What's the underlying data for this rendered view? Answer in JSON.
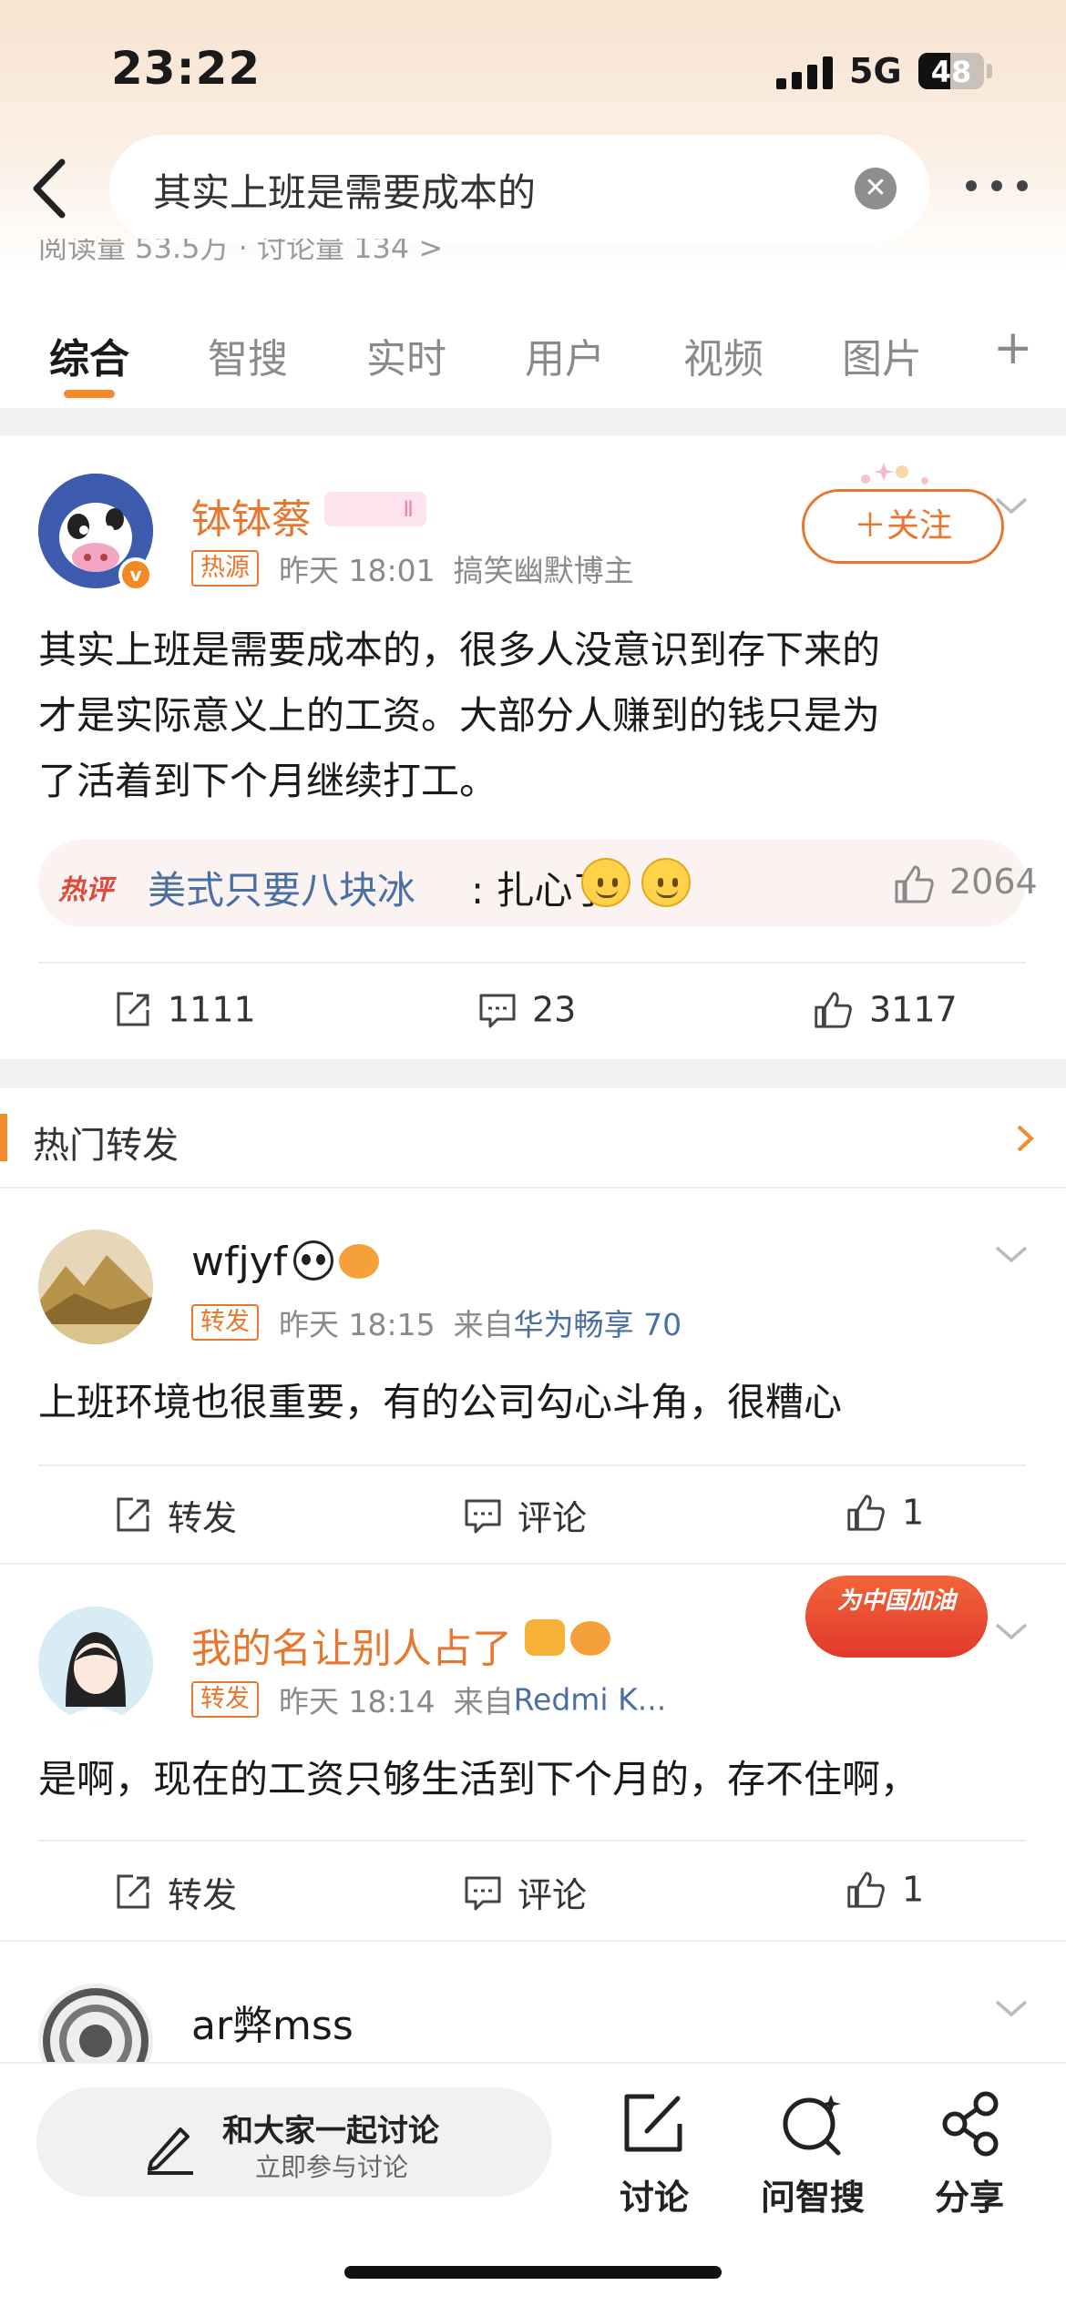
{
  "status": {
    "time": "23:22",
    "network": "5G",
    "battery": "48",
    "battery_level": 0.48
  },
  "search": {
    "query": "其实上班是需要成本的"
  },
  "peek": "阅读量 53.5万 · 讨论量 134 >",
  "tabs": [
    {
      "label": "综合"
    },
    {
      "label": "智搜"
    },
    {
      "label": "实时"
    },
    {
      "label": "用户"
    },
    {
      "label": "视频"
    },
    {
      "label": "图片"
    }
  ],
  "post": {
    "author": "钵钵蔡",
    "level": "Ⅱ",
    "tag": "热源",
    "time": "昨天 18:01",
    "desc": "搞笑幽默博主",
    "follow": "＋关注",
    "lines": [
      "其实上班是需要成本的，很多人没意识到存下来的",
      "才是实际意义上的工资。大部分人赚到的钱只是为",
      "了活着到下个月继续打工。"
    ],
    "hot_comment": {
      "label": "热评",
      "name": "美式只要八块冰",
      "text": ": 扎心了",
      "likes": "2064"
    },
    "reposts": "1111",
    "comments": "23",
    "likes": "3117"
  },
  "section_title": "热门转发",
  "reposts": [
    {
      "name": "wfjyf",
      "tag": "转发",
      "time": "昨天 18:15",
      "from": "来自",
      "device": "华为畅享 70",
      "text": "上班环境也很重要，有的公司勾心斗角，很糟心",
      "repost_label": "转发",
      "comment_label": "评论",
      "likes": "1"
    },
    {
      "name": "我的名让别人占了",
      "tag": "转发",
      "time": "昨天 18:14",
      "from": "来自",
      "device": "Redmi K...",
      "text": "是啊，现在的工资只够生活到下个月的，存不住啊，",
      "repost_label": "转发",
      "comment_label": "评论",
      "likes": "1",
      "badge": "为中国加油"
    },
    {
      "name": "ar弊mss"
    }
  ],
  "bottom": {
    "discuss_title": "和大家一起讨论",
    "discuss_sub": "立即参与讨论",
    "btn1": "讨论",
    "btn2": "问智搜",
    "btn3": "分享"
  }
}
